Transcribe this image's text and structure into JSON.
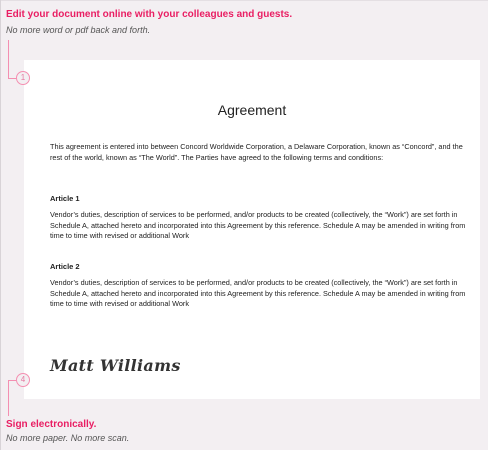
{
  "top_callout": {
    "title": "Edit your document online with your colleagues and guests.",
    "subtitle": "No more word or pdf back and forth.",
    "step": "1"
  },
  "document": {
    "title": "Agreement",
    "intro": "This agreement is entered into between Concord Worldwide Corporation, a Delaware Corporation, known as “Concord”, and the rest of the world, known as “The World”. The Parties have agreed to the following terms and conditions:",
    "articles": [
      {
        "heading": "Article 1",
        "body": "Vendor’s duties, description of services to be performed, and/or products to be created (collectively, the “Work”) are set forth in Schedule A, attached hereto and incorporated into this Agreement by this reference.  Schedule A may be amended in writing from time to time with revised or additional Work"
      },
      {
        "heading": "Article 2",
        "body": "Vendor’s duties, description of services to be performed, and/or products to be created (collectively, the “Work”) are set forth in Schedule A, attached hereto and incorporated into this Agreement by this reference.  Schedule A may be amended in writing from time to time with revised or additional Work"
      }
    ],
    "signature": "Matt Williams"
  },
  "bottom_callout": {
    "title": "Sign electronically.",
    "subtitle": "No more paper. No more scan.",
    "step": "4"
  },
  "colors": {
    "accent": "#e91e63",
    "marker": "#f48fb1",
    "background": "#f3eff2",
    "paper": "#ffffff"
  }
}
